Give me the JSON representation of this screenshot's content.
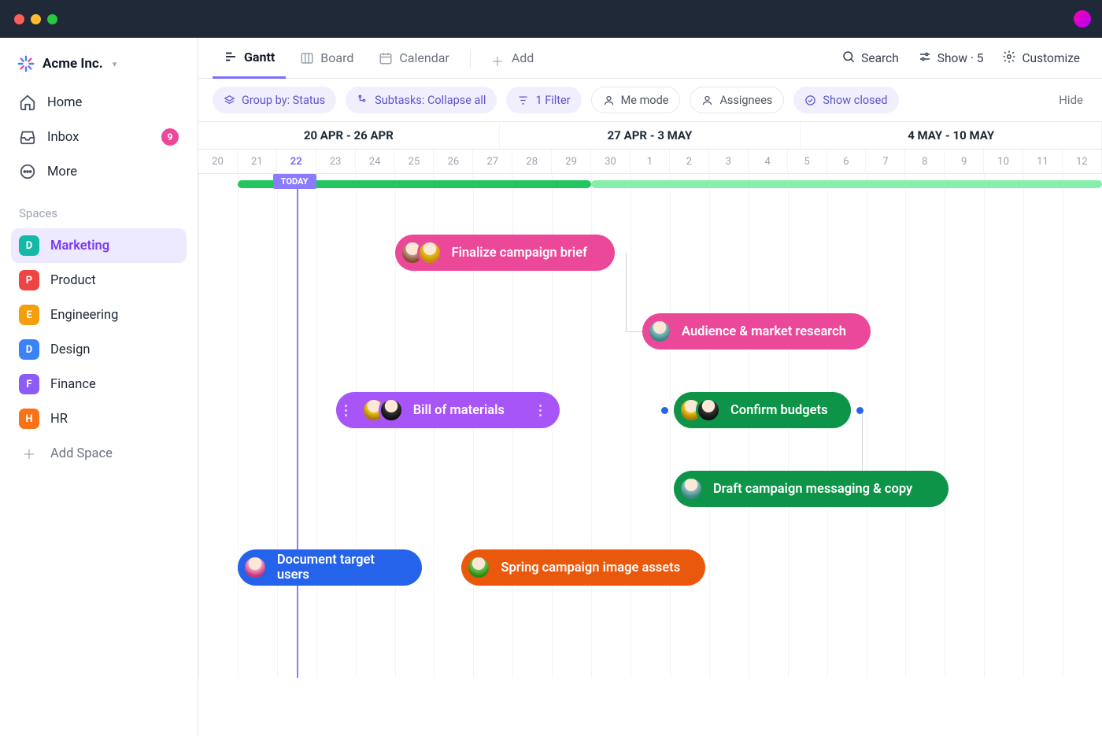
{
  "workspace": {
    "name": "Acme Inc."
  },
  "sidebar": {
    "nav": [
      {
        "label": "Home",
        "icon": "home"
      },
      {
        "label": "Inbox",
        "icon": "inbox",
        "badge": 9
      },
      {
        "label": "More",
        "icon": "more"
      }
    ],
    "sectionLabel": "Spaces",
    "spaces": [
      {
        "letter": "D",
        "label": "Marketing",
        "color": "#14b8a6",
        "active": true
      },
      {
        "letter": "P",
        "label": "Product",
        "color": "#ef4444"
      },
      {
        "letter": "E",
        "label": "Engineering",
        "color": "#f59e0b"
      },
      {
        "letter": "D",
        "label": "Design",
        "color": "#3b82f6"
      },
      {
        "letter": "F",
        "label": "Finance",
        "color": "#8b5cf6"
      },
      {
        "letter": "H",
        "label": "HR",
        "color": "#f97316"
      }
    ],
    "addSpace": "Add Space"
  },
  "viewTabs": {
    "gantt": "Gantt",
    "board": "Board",
    "calendar": "Calendar",
    "add": "Add"
  },
  "toolbar": {
    "search": "Search",
    "show": "Show · 5",
    "customize": "Customize"
  },
  "filters": {
    "groupBy": "Group by: Status",
    "subtasks": "Subtasks: Collapse all",
    "filter": "1 Filter",
    "meMode": "Me mode",
    "assignees": "Assignees",
    "showClosed": "Show closed",
    "hide": "Hide"
  },
  "timeline": {
    "weeks": [
      "20 APR - 26 APR",
      "27 APR - 3 MAY",
      "4 MAY - 10 MAY"
    ],
    "days": [
      "20",
      "21",
      "22",
      "23",
      "24",
      "25",
      "26",
      "27",
      "28",
      "29",
      "30",
      "1",
      "2",
      "3",
      "4",
      "5",
      "6",
      "7",
      "8",
      "9",
      "10",
      "11",
      "12"
    ],
    "todayIndex": 2,
    "todayLabel": "TODAY"
  },
  "tasks": [
    {
      "id": "t1",
      "label": "Finalize campaign brief",
      "color": "pink",
      "row": 0,
      "startDay": 5,
      "span": 5.6,
      "avatars": [
        "a1",
        "a2"
      ]
    },
    {
      "id": "t2",
      "label": "Audience & market research",
      "color": "pink",
      "row": 1,
      "startDay": 11.3,
      "span": 5.8,
      "avatars": [
        "a3"
      ]
    },
    {
      "id": "t3",
      "label": "Bill of materials",
      "color": "violet",
      "row": 2,
      "startDay": 3.5,
      "span": 5.7,
      "avatars": [
        "a4",
        "a6"
      ],
      "grips": true
    },
    {
      "id": "t4",
      "label": "Confirm budgets",
      "color": "green",
      "row": 2,
      "startDay": 12.1,
      "span": 4.5,
      "avatars": [
        "a4",
        "a6"
      ],
      "depDots": true
    },
    {
      "id": "t5",
      "label": "Draft campaign messaging & copy",
      "color": "green",
      "row": 3,
      "startDay": 12.1,
      "span": 7.0,
      "avatars": [
        "a3"
      ]
    },
    {
      "id": "t6",
      "label": "Document target users",
      "color": "blue",
      "row": 4,
      "startDay": 1.0,
      "span": 4.7,
      "avatars": [
        "a5"
      ]
    },
    {
      "id": "t7",
      "label": "Spring campaign image assets",
      "color": "orange",
      "row": 4,
      "startDay": 6.7,
      "span": 6.2,
      "avatars": [
        "a7"
      ]
    }
  ],
  "chart_data": {
    "type": "gantt",
    "title": "Marketing Gantt",
    "date_range": {
      "start": "2020-04-20",
      "end": "2020-05-12"
    },
    "today": "2020-04-22",
    "weeks": [
      "20 APR - 26 APR",
      "27 APR - 3 MAY",
      "4 MAY - 10 MAY"
    ],
    "sprints": [
      {
        "start": "2020-04-21",
        "end": "2020-04-30",
        "color": "#22c55e"
      },
      {
        "start": "2020-04-30",
        "end": "2020-05-12",
        "color": "#86efac"
      }
    ],
    "tasks": [
      {
        "name": "Finalize campaign brief",
        "start": "2020-04-25",
        "end": "2020-04-30",
        "status": "pink",
        "assignees": 2
      },
      {
        "name": "Audience & market research",
        "start": "2020-05-01",
        "end": "2020-05-06",
        "status": "pink",
        "assignees": 1
      },
      {
        "name": "Bill of materials",
        "start": "2020-04-23",
        "end": "2020-04-29",
        "status": "violet",
        "assignees": 2
      },
      {
        "name": "Confirm budgets",
        "start": "2020-05-02",
        "end": "2020-05-06",
        "status": "green",
        "assignees": 2
      },
      {
        "name": "Draft campaign messaging & copy",
        "start": "2020-05-02",
        "end": "2020-05-09",
        "status": "green",
        "assignees": 1
      },
      {
        "name": "Document target users",
        "start": "2020-04-21",
        "end": "2020-04-25",
        "status": "blue",
        "assignees": 1
      },
      {
        "name": "Spring campaign image assets",
        "start": "2020-04-27",
        "end": "2020-05-03",
        "status": "orange",
        "assignees": 1
      }
    ],
    "dependencies": [
      {
        "from": "Finalize campaign brief",
        "to": "Audience & market research"
      },
      {
        "from": "Confirm budgets",
        "to": "Draft campaign messaging & copy"
      }
    ]
  }
}
